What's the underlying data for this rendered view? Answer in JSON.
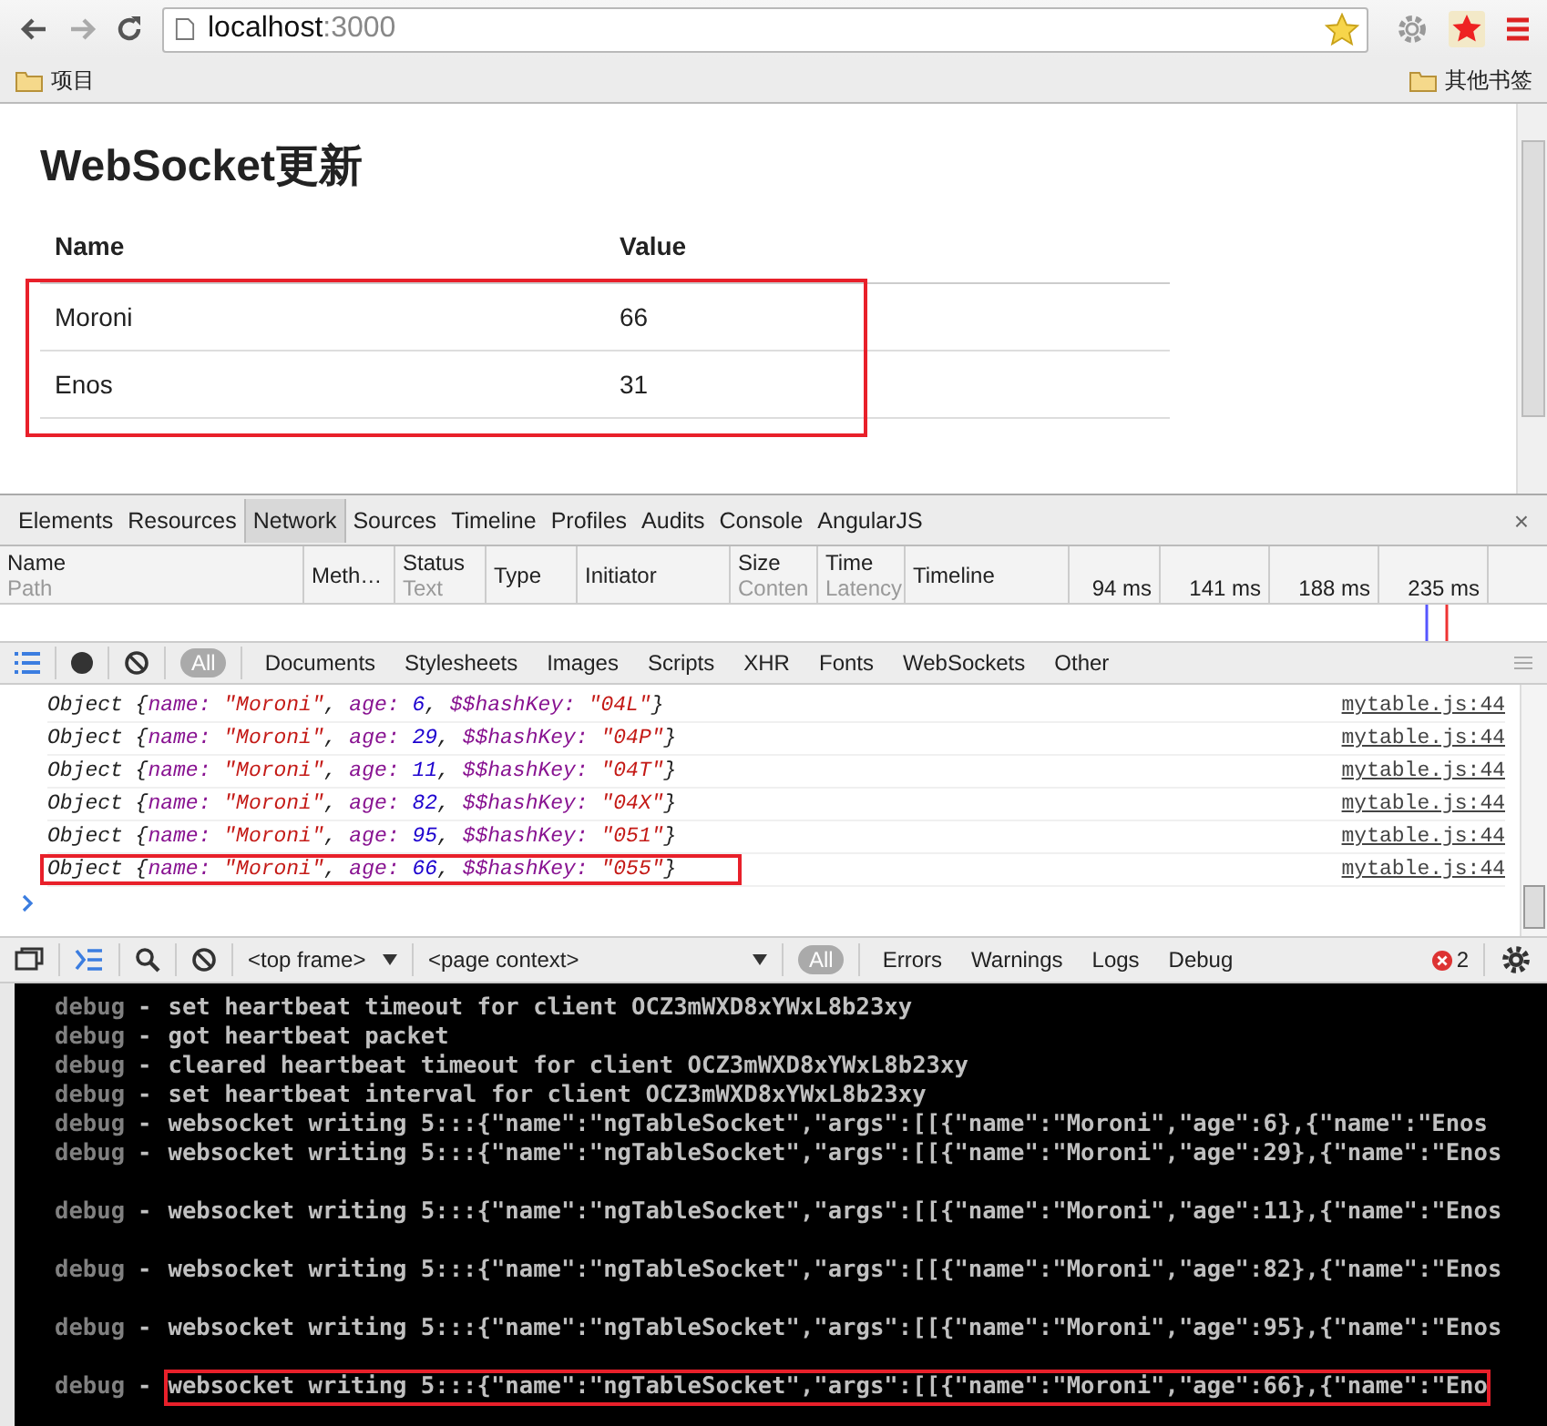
{
  "browser": {
    "url_host": "localhost",
    "url_port": ":3000",
    "bookmarks_left": "项目",
    "bookmarks_right": "其他书签"
  },
  "page": {
    "heading": "WebSocket更新",
    "columns": [
      "Name",
      "Value"
    ],
    "highlighted": true,
    "rows": [
      {
        "name": "Moroni",
        "value": "66"
      },
      {
        "name": "Enos",
        "value": "31"
      }
    ]
  },
  "devtools": {
    "tabs": [
      {
        "label": "Elements",
        "selected": false
      },
      {
        "label": "Resources",
        "selected": false
      },
      {
        "label": "Network",
        "selected": true
      },
      {
        "label": "Sources",
        "selected": false
      },
      {
        "label": "Timeline",
        "selected": false
      },
      {
        "label": "Profiles",
        "selected": false
      },
      {
        "label": "Audits",
        "selected": false
      },
      {
        "label": "Console",
        "selected": false
      },
      {
        "label": "AngularJS",
        "selected": false
      }
    ],
    "close": "×",
    "network_columns": [
      {
        "title": "Name",
        "sub": "Path"
      },
      {
        "title": "Meth…"
      },
      {
        "title": "Status",
        "sub": "Text"
      },
      {
        "title": "Type"
      },
      {
        "title": "Initiator"
      },
      {
        "title": "Size",
        "sub": "Conten"
      },
      {
        "title": "Time",
        "sub": "Latency"
      },
      {
        "title": "Timeline"
      }
    ],
    "timeline_ticks": [
      "94 ms",
      "141 ms",
      "188 ms",
      "235 ms"
    ],
    "filters": [
      {
        "label": "All",
        "selected": true
      },
      {
        "label": "Documents",
        "selected": false
      },
      {
        "label": "Stylesheets",
        "selected": false
      },
      {
        "label": "Images",
        "selected": false
      },
      {
        "label": "Scripts",
        "selected": false
      },
      {
        "label": "XHR",
        "selected": false
      },
      {
        "label": "Fonts",
        "selected": false
      },
      {
        "label": "WebSockets",
        "selected": false
      },
      {
        "label": "Other",
        "selected": false
      }
    ],
    "console_lines": [
      {
        "highlighted": false,
        "source": "mytable.js:44",
        "parts": [
          {
            "kind": "plain",
            "text": "Object {"
          },
          {
            "kind": "key",
            "text": "name: "
          },
          {
            "kind": "string",
            "text": "\"Moroni\""
          },
          {
            "kind": "plain",
            "text": ", "
          },
          {
            "kind": "key",
            "text": "age: "
          },
          {
            "kind": "number",
            "text": "6"
          },
          {
            "kind": "plain",
            "text": ", "
          },
          {
            "kind": "key",
            "text": "$$hashKey: "
          },
          {
            "kind": "string",
            "text": "\"04L\""
          },
          {
            "kind": "plain",
            "text": "}"
          }
        ]
      },
      {
        "highlighted": false,
        "source": "mytable.js:44",
        "parts": [
          {
            "kind": "plain",
            "text": "Object {"
          },
          {
            "kind": "key",
            "text": "name: "
          },
          {
            "kind": "string",
            "text": "\"Moroni\""
          },
          {
            "kind": "plain",
            "text": ", "
          },
          {
            "kind": "key",
            "text": "age: "
          },
          {
            "kind": "number",
            "text": "29"
          },
          {
            "kind": "plain",
            "text": ", "
          },
          {
            "kind": "key",
            "text": "$$hashKey: "
          },
          {
            "kind": "string",
            "text": "\"04P\""
          },
          {
            "kind": "plain",
            "text": "}"
          }
        ]
      },
      {
        "highlighted": false,
        "source": "mytable.js:44",
        "parts": [
          {
            "kind": "plain",
            "text": "Object {"
          },
          {
            "kind": "key",
            "text": "name: "
          },
          {
            "kind": "string",
            "text": "\"Moroni\""
          },
          {
            "kind": "plain",
            "text": ", "
          },
          {
            "kind": "key",
            "text": "age: "
          },
          {
            "kind": "number",
            "text": "11"
          },
          {
            "kind": "plain",
            "text": ", "
          },
          {
            "kind": "key",
            "text": "$$hashKey: "
          },
          {
            "kind": "string",
            "text": "\"04T\""
          },
          {
            "kind": "plain",
            "text": "}"
          }
        ]
      },
      {
        "highlighted": false,
        "source": "mytable.js:44",
        "parts": [
          {
            "kind": "plain",
            "text": "Object {"
          },
          {
            "kind": "key",
            "text": "name: "
          },
          {
            "kind": "string",
            "text": "\"Moroni\""
          },
          {
            "kind": "plain",
            "text": ", "
          },
          {
            "kind": "key",
            "text": "age: "
          },
          {
            "kind": "number",
            "text": "82"
          },
          {
            "kind": "plain",
            "text": ", "
          },
          {
            "kind": "key",
            "text": "$$hashKey: "
          },
          {
            "kind": "string",
            "text": "\"04X\""
          },
          {
            "kind": "plain",
            "text": "}"
          }
        ]
      },
      {
        "highlighted": false,
        "source": "mytable.js:44",
        "parts": [
          {
            "kind": "plain",
            "text": "Object {"
          },
          {
            "kind": "key",
            "text": "name: "
          },
          {
            "kind": "string",
            "text": "\"Moroni\""
          },
          {
            "kind": "plain",
            "text": ", "
          },
          {
            "kind": "key",
            "text": "age: "
          },
          {
            "kind": "number",
            "text": "95"
          },
          {
            "kind": "plain",
            "text": ", "
          },
          {
            "kind": "key",
            "text": "$$hashKey: "
          },
          {
            "kind": "string",
            "text": "\"051\""
          },
          {
            "kind": "plain",
            "text": "}"
          }
        ]
      },
      {
        "highlighted": true,
        "source": "mytable.js:44",
        "parts": [
          {
            "kind": "plain",
            "text": "Object {"
          },
          {
            "kind": "key",
            "text": "name: "
          },
          {
            "kind": "string",
            "text": "\"Moroni\""
          },
          {
            "kind": "plain",
            "text": ", "
          },
          {
            "kind": "key",
            "text": "age: "
          },
          {
            "kind": "number",
            "text": "66"
          },
          {
            "kind": "plain",
            "text": ", "
          },
          {
            "kind": "key",
            "text": "$$hashKey: "
          },
          {
            "kind": "string",
            "text": "\"055\""
          },
          {
            "kind": "plain",
            "text": "}"
          }
        ]
      }
    ],
    "frame_select": "<top frame>",
    "context_select": "<page context>",
    "levels": [
      {
        "label": "All",
        "selected": true
      },
      {
        "label": "Errors",
        "selected": false
      },
      {
        "label": "Warnings",
        "selected": false
      },
      {
        "label": "Logs",
        "selected": false
      },
      {
        "label": "Debug",
        "selected": false
      }
    ],
    "error_count": "2"
  },
  "terminal": [
    {
      "level": "debug",
      "dash": "-",
      "message": "set heartbeat timeout for client OCZ3mWXD8xYWxL8b23xy",
      "blank_before": false,
      "highlighted": false
    },
    {
      "level": "debug",
      "dash": "-",
      "message": "got heartbeat packet",
      "blank_before": false,
      "highlighted": false
    },
    {
      "level": "debug",
      "dash": "-",
      "message": "cleared heartbeat timeout for client OCZ3mWXD8xYWxL8b23xy",
      "blank_before": false,
      "highlighted": false
    },
    {
      "level": "debug",
      "dash": "-",
      "message": "set heartbeat interval for client OCZ3mWXD8xYWxL8b23xy",
      "blank_before": false,
      "highlighted": false
    },
    {
      "level": "debug",
      "dash": "-",
      "message": "websocket writing 5:::{\"name\":\"ngTableSocket\",\"args\":[[{\"name\":\"Moroni\",\"age\":6},{\"name\":\"Enos",
      "blank_before": false,
      "highlighted": false
    },
    {
      "level": "debug",
      "dash": "-",
      "message": "websocket writing 5:::{\"name\":\"ngTableSocket\",\"args\":[[{\"name\":\"Moroni\",\"age\":29},{\"name\":\"Enos",
      "blank_before": false,
      "highlighted": false
    },
    {
      "level": "debug",
      "dash": "-",
      "message": "websocket writing 5:::{\"name\":\"ngTableSocket\",\"args\":[[{\"name\":\"Moroni\",\"age\":11},{\"name\":\"Enos",
      "blank_before": true,
      "highlighted": false
    },
    {
      "level": "debug",
      "dash": "-",
      "message": "websocket writing 5:::{\"name\":\"ngTableSocket\",\"args\":[[{\"name\":\"Moroni\",\"age\":82},{\"name\":\"Enos",
      "blank_before": true,
      "highlighted": false
    },
    {
      "level": "debug",
      "dash": "-",
      "message": "websocket writing 5:::{\"name\":\"ngTableSocket\",\"args\":[[{\"name\":\"Moroni\",\"age\":95},{\"name\":\"Enos",
      "blank_before": true,
      "highlighted": false
    },
    {
      "level": "debug",
      "dash": "-",
      "message": "websocket writing 5:::{\"name\":\"ngTableSocket\",\"args\":[[{\"name\":\"Moroni\",\"age\":66},{\"name\":\"Eno",
      "blank_before": true,
      "highlighted": true
    }
  ]
}
